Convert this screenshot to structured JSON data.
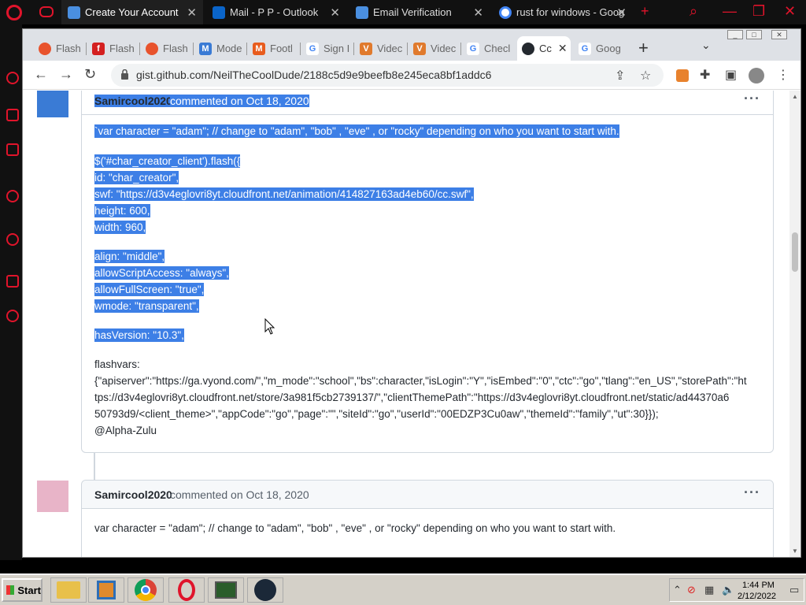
{
  "opera_tabs": [
    {
      "label": "Create Your Account",
      "active": true
    },
    {
      "label": "Mail - P P - Outlook",
      "active": false
    },
    {
      "label": "Email Verification",
      "active": false
    },
    {
      "label": "rust for windows - Goog",
      "active": false
    }
  ],
  "chrome_tabs": [
    {
      "label": "Flash",
      "icon": "flash-icon"
    },
    {
      "label": "Flash",
      "icon": "flash-player-icon"
    },
    {
      "label": "Flash",
      "icon": "flash-icon"
    },
    {
      "label": "Mode",
      "icon": "m-icon"
    },
    {
      "label": "Footl",
      "icon": "m-orange-icon"
    },
    {
      "label": "Sign I",
      "icon": "google-icon"
    },
    {
      "label": "Videc",
      "icon": "v-icon"
    },
    {
      "label": "Videc",
      "icon": "v-icon"
    },
    {
      "label": "Checl",
      "icon": "google-icon"
    },
    {
      "label": "Cc",
      "icon": "github-icon",
      "active": true
    },
    {
      "label": "Goog",
      "icon": "google-icon"
    }
  ],
  "url": "gist.github.com/NeilTheCoolDude/2188c5d9e9beefb8e245eca8bf1addc6",
  "comments": [
    {
      "author": "Samircool2020",
      "meta": "commented on Oct 18, 2020",
      "highlighted_lines": [
        "`var character = \"adam\"; // change to \"adam\", \"bob\" , \"eve\" , or \"rocky\" depending on who you want to start with.",
        "$('#char_creator_client').flash({",
        "id: \"char_creator\",",
        "swf: \"https://d3v4eglovri8yt.cloudfront.net/animation/414827163ad4eb60/cc.swf\",",
        "height: 600,",
        "width: 960,",
        "align: \"middle\",",
        "allowScriptAccess: \"always\",",
        "allowFullScreen: \"true\",",
        "wmode: \"transparent\",",
        "hasVersion: \"10.3\","
      ],
      "plain_lines": [
        "flashvars:",
        "{\"apiserver\":\"https://ga.vyond.com/\",\"m_mode\":\"school\",\"bs\":character,\"isLogin\":\"Y\",\"isEmbed\":\"0\",\"ctc\":\"go\",\"tlang\":\"en_US\",\"storePath\":\"ht",
        "tps://d3v4eglovri8yt.cloudfront.net/store/3a981f5cb2739137/\",\"clientThemePath\":\"https://d3v4eglovri8yt.cloudfront.net/static/ad44370a6",
        "50793d9/<client_theme>\",\"appCode\":\"go\",\"page\":\"\",\"siteId\":\"go\",\"userId\":\"00EDZP3Cu0aw\",\"themeId\":\"family\",\"ut\":30}});",
        "@Alpha-Zulu"
      ]
    },
    {
      "author": "Samircool2020",
      "meta": "commented on Oct 18, 2020",
      "plain_lines": [
        "var character = \"adam\"; // change to \"adam\", \"bob\" , \"eve\" , or \"rocky\" depending on who you want to start with."
      ]
    }
  ],
  "more_options": "···",
  "taskbar": {
    "start_label": "Start",
    "time": "1:44 PM",
    "date": "2/12/2022"
  },
  "colors": {
    "highlight": "#3d7fe6",
    "opera_red": "#e0142b"
  }
}
